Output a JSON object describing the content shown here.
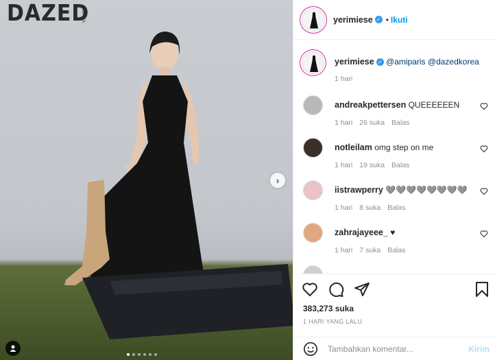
{
  "photo": {
    "logo": "DAZED",
    "logo_sub": "KOREA",
    "carousel_dots": 6,
    "active_dot": 0
  },
  "header": {
    "username": "yerimiese",
    "follow_label": "Ikuti",
    "separator": "•"
  },
  "caption": {
    "username": "yerimiese",
    "mentions": "@amiparis @dazedkorea",
    "age": "1 hari"
  },
  "comments": [
    {
      "username": "andreakpettersen",
      "text": "QUEEEEEEN",
      "age": "1 hari",
      "likes": "26 suka",
      "reply": "Balas"
    },
    {
      "username": "notleilam",
      "text": "omg step on me",
      "age": "1 hari",
      "likes": "19 suka",
      "reply": "Balas"
    },
    {
      "username": "iistrawperry",
      "text": "🩶🩶🩶🩶🩶🩶🩶🩶",
      "age": "1 hari",
      "likes": "8 suka",
      "reply": "Balas"
    },
    {
      "username": "zahrajayeee_",
      "text": "♥",
      "age": "1 hari",
      "likes": "7 suka",
      "reply": "Balas"
    }
  ],
  "actions": {
    "likes": "383,273 suka",
    "timestamp": "1 HARI YANG LALU"
  },
  "comment_box": {
    "placeholder": "Tambahkan komentar...",
    "post_label": "Kirim"
  },
  "colors": {
    "accent": "#0095f6",
    "verified": "#3897f0",
    "post_disabled": "#b2dffc"
  }
}
